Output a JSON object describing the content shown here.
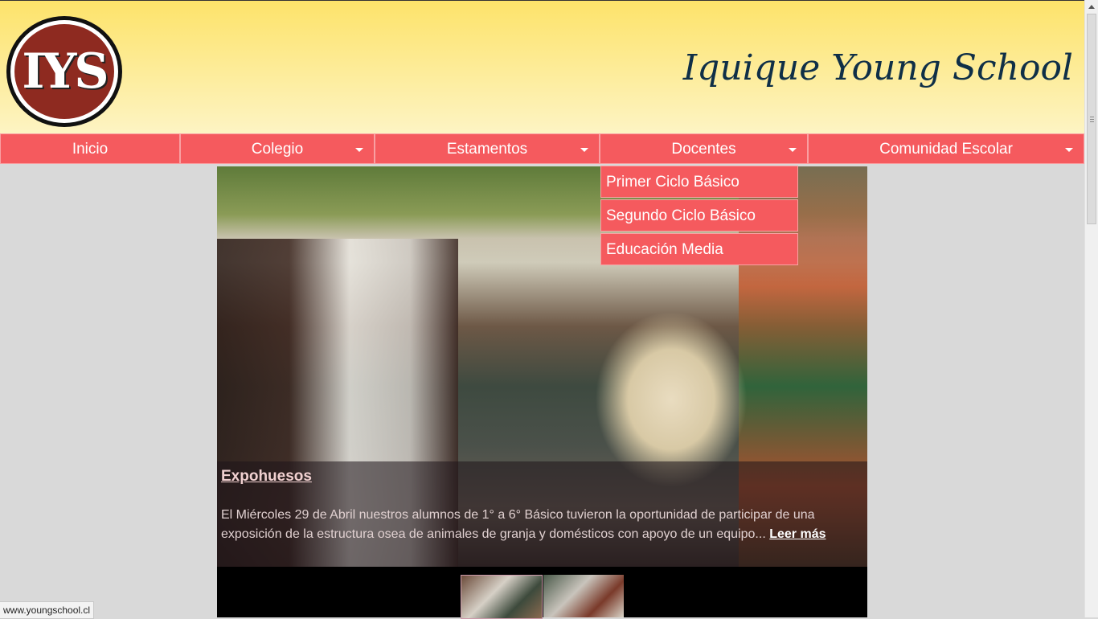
{
  "header": {
    "logo_text": "IYS",
    "site_title": "Iquique Young School"
  },
  "nav": {
    "items": [
      {
        "label": "Inicio",
        "has_dropdown": false
      },
      {
        "label": "Colegio",
        "has_dropdown": true
      },
      {
        "label": "Estamentos",
        "has_dropdown": true
      },
      {
        "label": "Docentes",
        "has_dropdown": true
      },
      {
        "label": "Comunidad Escolar",
        "has_dropdown": true
      }
    ],
    "open_dropdown": {
      "parent": "Docentes",
      "items": [
        "Primer Ciclo Básico",
        "Segundo Ciclo Básico",
        "Educación Media"
      ]
    }
  },
  "slider": {
    "title": "Expohuesos",
    "text": "El Miércoles 29 de Abril nuestros alumnos de 1° a 6° Básico tuvieron la oportunidad de participar de una exposición de la estructura osea de animales de granja y domésticos con apoyo de un equipo...",
    "read_more": "Leer más"
  },
  "status_bar": {
    "url": "www.youngschool.cl"
  },
  "colors": {
    "nav_bg": "#f55a5e",
    "header_gradient_top": "#fde36a",
    "title_color": "#0f2f47",
    "logo_red": "#8e2a20"
  }
}
